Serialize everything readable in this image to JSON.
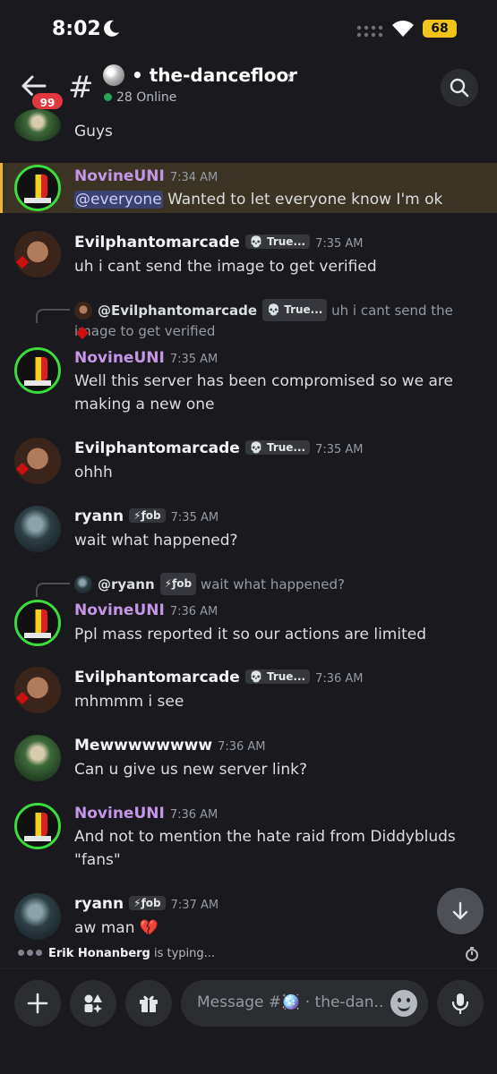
{
  "status": {
    "time": "8:02",
    "battery": "68"
  },
  "header": {
    "back_badge": "99",
    "channel_name": "• the-dancefloor",
    "online": "28 Online"
  },
  "messages": [
    {
      "text": "Guys"
    },
    {
      "author": "NovineUNI",
      "time": "7:34 AM",
      "mention": "@everyone",
      "text": " Wanted to let everyone know I'm ok"
    },
    {
      "author": "Evilphantomarcade",
      "tag": "💀 True...",
      "time": "7:35 AM",
      "text": "uh i cant send the image to get verified"
    },
    {
      "reply_author": "@Evilphantomarcade",
      "reply_tag": "💀 True...",
      "reply_text": "uh i cant send the image to get verified",
      "author": "NovineUNI",
      "time": "7:35 AM",
      "text": "Well this server has been compromised so we are making a new one"
    },
    {
      "author": "Evilphantomarcade",
      "tag": "💀 True...",
      "time": "7:35 AM",
      "text": "ohhh"
    },
    {
      "author": "ryann",
      "tag": "⚡ƒob",
      "time": "7:35 AM",
      "text": "wait what happened?"
    },
    {
      "reply_author": "@ryann",
      "reply_tag": "⚡ƒob",
      "reply_text": "wait what happened?",
      "author": "NovineUNI",
      "time": "7:36 AM",
      "text": "Ppl mass reported it so our actions are limited"
    },
    {
      "author": "Evilphantomarcade",
      "tag": "💀 True...",
      "time": "7:36 AM",
      "text": "mhmmm i see"
    },
    {
      "author": "Mewwwwwwww",
      "time": "7:36 AM",
      "text": "Can u give us new server link?"
    },
    {
      "author": "NovineUNI",
      "time": "7:36 AM",
      "text": "And not to mention the hate raid from Diddybluds \"fans\""
    },
    {
      "author": "ryann",
      "tag": "⚡ƒob",
      "time": "7:37 AM",
      "text": "aw man 💔"
    }
  ],
  "typing": {
    "user": "Erik Honanberg",
    "suffix": " is typing..."
  },
  "composer": {
    "placeholder": "Message #🪩 · the-dan..."
  },
  "colors": {
    "accent_novine": "#c396e6",
    "highlight_bar": "#f0b232",
    "online": "#23a55a",
    "badge": "#e0383e"
  }
}
